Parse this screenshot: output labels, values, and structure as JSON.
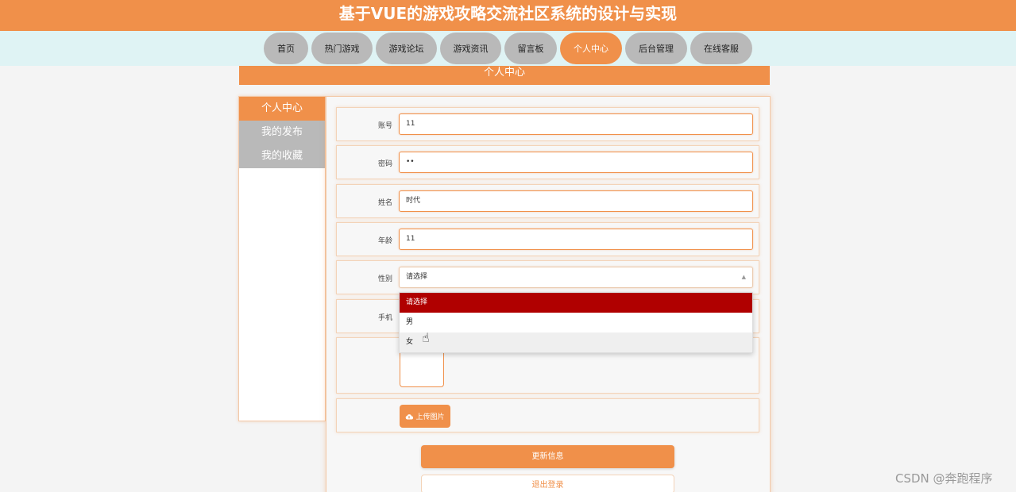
{
  "header": {
    "title": "基于VUE的游戏攻略交流社区系统的设计与实现"
  },
  "nav": {
    "items": [
      {
        "label": "首页"
      },
      {
        "label": "热门游戏"
      },
      {
        "label": "游戏论坛"
      },
      {
        "label": "游戏资讯"
      },
      {
        "label": "留言板"
      },
      {
        "label": "个人中心"
      },
      {
        "label": "后台管理"
      },
      {
        "label": "在线客服"
      }
    ],
    "active": "个人中心"
  },
  "section": {
    "title": "个人中心"
  },
  "sidebar": {
    "items": [
      {
        "label": "个人中心"
      },
      {
        "label": "我的发布"
      },
      {
        "label": "我的收藏"
      }
    ],
    "active": "个人中心"
  },
  "form": {
    "account": {
      "label": "账号",
      "value": "11"
    },
    "password": {
      "label": "密码",
      "value": "••"
    },
    "name": {
      "label": "姓名",
      "value": "时代"
    },
    "age": {
      "label": "年龄",
      "value": "11"
    },
    "gender": {
      "label": "性别",
      "placeholder": "请选择",
      "options": [
        "请选择",
        "男",
        "女"
      ],
      "highlighted": "请选择",
      "hovered": "女"
    },
    "phone": {
      "label": "手机"
    },
    "upload": {
      "label": "上传图片"
    }
  },
  "buttons": {
    "update": "更新信息",
    "logout": "退出登录"
  },
  "watermark": "CSDN @奔跑程序",
  "colors": {
    "accent": "#f0904a",
    "nav_bg": "#dff3f4",
    "inactive": "#b9b9b9",
    "selected_option": "#b00000"
  }
}
